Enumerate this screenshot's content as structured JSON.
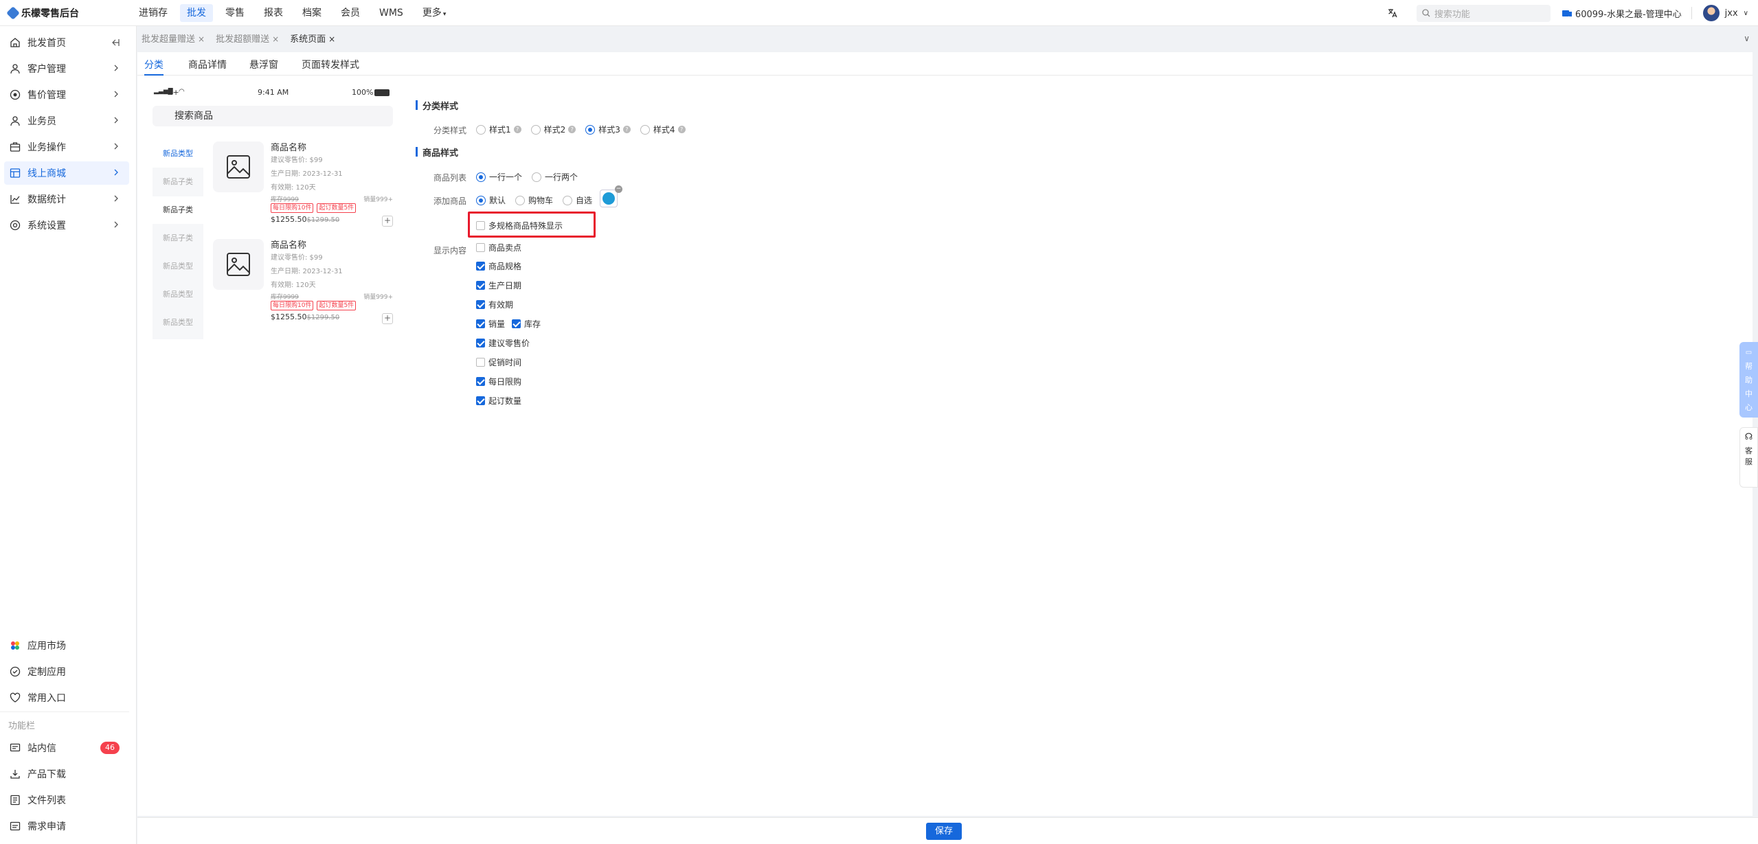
{
  "app": {
    "title": "乐檬零售后台"
  },
  "topnav": [
    "进销存",
    "批发",
    "零售",
    "报表",
    "档案",
    "会员",
    "WMS",
    "更多"
  ],
  "search": {
    "placeholder": "搜索功能"
  },
  "store": "60099-水果之最-管理中心",
  "user": "jxx",
  "sidebar": {
    "items": [
      {
        "label": "批发首页",
        "icon": "home-icon"
      },
      {
        "label": "客户管理",
        "icon": "user-icon"
      },
      {
        "label": "售价管理",
        "icon": "price-icon"
      },
      {
        "label": "业务员",
        "icon": "user-icon"
      },
      {
        "label": "业务操作",
        "icon": "briefcase-icon"
      },
      {
        "label": "线上商城",
        "icon": "store-icon"
      },
      {
        "label": "数据统计",
        "icon": "chart-icon"
      },
      {
        "label": "系统设置",
        "icon": "gear-icon"
      }
    ],
    "apps": [
      {
        "label": "应用市场",
        "icon": "app-market-icon"
      },
      {
        "label": "定制应用",
        "icon": "custom-app-icon"
      },
      {
        "label": "常用入口",
        "icon": "heart-icon"
      }
    ],
    "func_title": "功能栏",
    "funcs": [
      {
        "label": "站内信",
        "icon": "message-icon",
        "badge": "46"
      },
      {
        "label": "产品下载",
        "icon": "download-icon"
      },
      {
        "label": "文件列表",
        "icon": "file-list-icon"
      },
      {
        "label": "需求申请",
        "icon": "request-icon"
      }
    ]
  },
  "page_tabs": [
    {
      "label": "批发超量赠送"
    },
    {
      "label": "批发超额赠送"
    },
    {
      "label": "系统页面"
    }
  ],
  "sub_tabs": [
    "分类",
    "商品详情",
    "悬浮窗",
    "页面转发样式"
  ],
  "phone": {
    "carrier": "Z+",
    "time": "9:41 AM",
    "battery": "100%",
    "search": "搜索商品",
    "categories": [
      "新品类型",
      "新品子类",
      "新品子类",
      "新品子类",
      "新品类型",
      "新品类型",
      "新品类型"
    ],
    "products": [
      {
        "name": "商品名称",
        "price_hint": "建议零售价: $99",
        "date": "生产日期: 2023-12-31",
        "validity": "有效期: 120天",
        "stock": "库存9999",
        "sales": "销量999+",
        "tag1": "每日限购10件",
        "tag2": "起订数量5件",
        "price": "$1255.50",
        "old_price": "$1299.50"
      },
      {
        "name": "商品名称",
        "price_hint": "建议零售价: $99",
        "date": "生产日期: 2023-12-31",
        "validity": "有效期: 120天",
        "stock": "库存9999",
        "sales": "销量999+",
        "tag1": "每日限购10件",
        "tag2": "起订数量5件",
        "price": "$1255.50",
        "old_price": "$1299.50"
      }
    ]
  },
  "form": {
    "sec_category": "分类样式",
    "cat_style_label": "分类样式",
    "cat_styles": [
      "样式1",
      "样式2",
      "样式3",
      "样式4"
    ],
    "cat_selected": "样式3",
    "sec_product": "商品样式",
    "list_label": "商品列表",
    "list_options": [
      "一行一个",
      "一行两个"
    ],
    "list_selected": "一行一个",
    "add_label": "添加商品",
    "add_options": [
      "默认",
      "购物车",
      "自选"
    ],
    "add_selected": "默认",
    "multi_spec": {
      "label": "多规格商品特殊显示",
      "checked": false
    },
    "display_label": "显示内容",
    "display_items": [
      {
        "label": "商品卖点",
        "checked": false
      },
      {
        "label": "商品规格",
        "checked": true
      },
      {
        "label": "生产日期",
        "checked": true
      },
      {
        "label": "有效期",
        "checked": true
      },
      {
        "label": "销量",
        "checked": true
      },
      {
        "label": "库存",
        "checked": true
      },
      {
        "label": "建议零售价",
        "checked": true
      },
      {
        "label": "促销时间",
        "checked": false
      },
      {
        "label": "每日限购",
        "checked": true
      },
      {
        "label": "起订数量",
        "checked": true
      }
    ]
  },
  "footer": {
    "save": "保存"
  },
  "right_float": {
    "help": [
      "帮",
      "助",
      "中",
      "心"
    ],
    "service": [
      "客",
      "服"
    ]
  },
  "colors": {
    "accent": "#1668dc",
    "highlight": "#e8192c",
    "badge": "#f5414d"
  }
}
